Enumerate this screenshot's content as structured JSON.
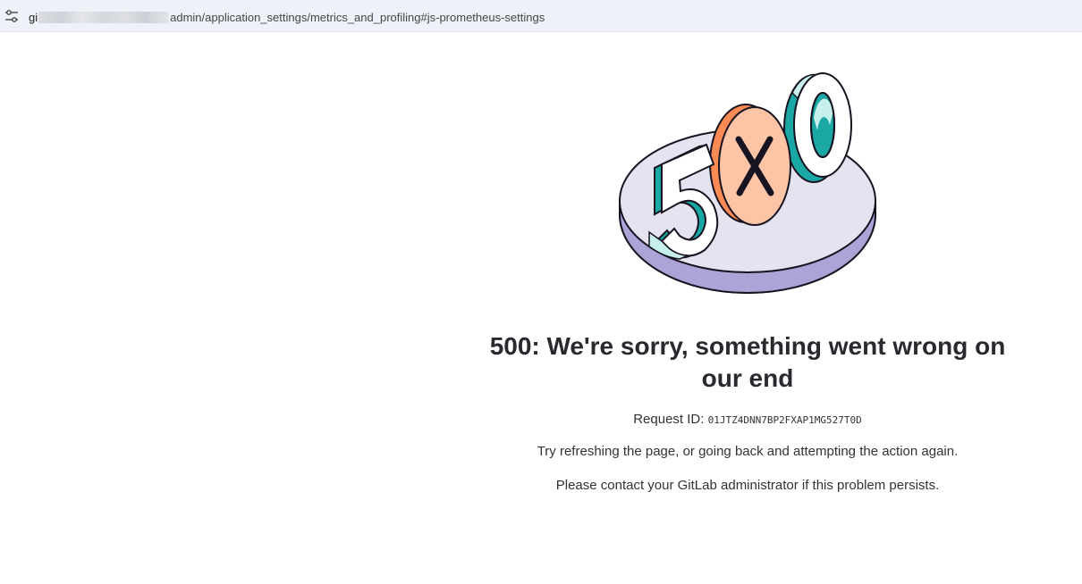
{
  "browser": {
    "url_prefix": "gi",
    "url_path": "admin/application_settings/metrics_and_profiling#js-prometheus-settings",
    "site_info_icon": "tune-icon"
  },
  "illustration": {
    "icon": "error-500-illustration",
    "colors": {
      "platform_top": "#e5e3ef",
      "platform_side": "#aca3d6",
      "teal": "#1aa8a5",
      "mint": "#c7f0eb",
      "orange": "#fc8a55",
      "peach": "#fdc4a6",
      "outline": "#171321"
    }
  },
  "error": {
    "title": "500: We're sorry, something went wrong on our end",
    "request_label": "Request ID:",
    "request_id": "01JTZ4DNN7BP2FXAP1MG527T0D",
    "message_1": "Try refreshing the page, or going back and attempting the action again.",
    "message_2": "Please contact your GitLab administrator if this problem persists."
  }
}
